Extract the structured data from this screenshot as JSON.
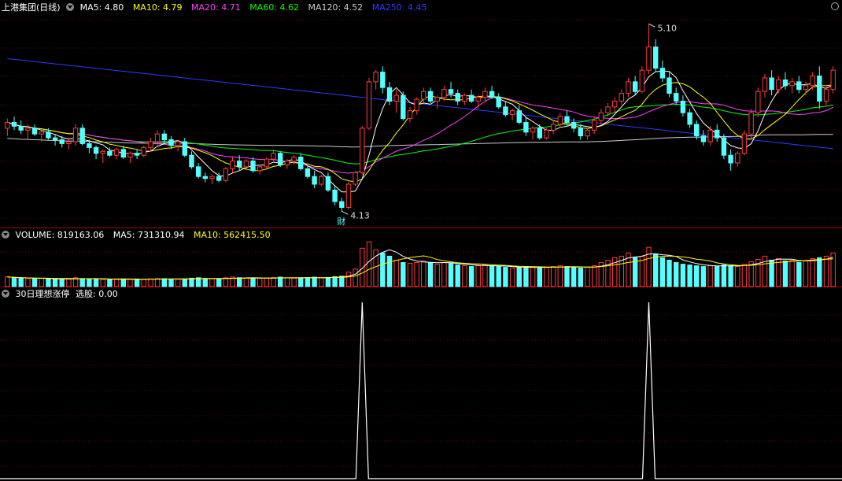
{
  "stock_name": "上港集团(日线)",
  "colors": {
    "up": "#ff3b3b",
    "down": "#54ffff",
    "ma5": "#ffffff",
    "ma10": "#ffff00",
    "ma20": "#ff40ff",
    "ma60": "#00ff00",
    "ma120": "#cccccc",
    "ma250": "#2b3bff",
    "grid": "#6b0000",
    "border": "#a00000"
  },
  "price_panel": {
    "legend": [
      {
        "key": "ma5",
        "label": "MA5: 4.80"
      },
      {
        "key": "ma10",
        "label": "MA10: 4.79"
      },
      {
        "key": "ma20",
        "label": "MA20: 4.71"
      },
      {
        "key": "ma60",
        "label": "MA60: 4.62"
      },
      {
        "key": "ma120",
        "label": "MA120: 4.52"
      },
      {
        "key": "ma250",
        "label": "MA250: 4.45"
      }
    ],
    "high_label": "5.10",
    "low_label": "4.13",
    "event_marker": "财"
  },
  "volume_panel": {
    "legend": [
      {
        "key": "vol",
        "label": "VOLUME: 819163.06",
        "color": "#ffffff"
      },
      {
        "key": "ma5",
        "label": "MA5: 731310.94",
        "color": "#ffffff"
      },
      {
        "key": "ma10",
        "label": "MA10: 562415.50",
        "color": "#ffff00"
      }
    ]
  },
  "indicator_panel": {
    "legend": [
      {
        "key": "name",
        "label": "30日理想涨停",
        "color": "#ffffff"
      },
      {
        "key": "val",
        "label": "选股: 0.00",
        "color": "#ffffff"
      }
    ]
  },
  "chart_data": {
    "type": "candlestick",
    "title": "上港集团(日线)",
    "ylim": [
      4.05,
      5.15
    ],
    "candles": [
      [
        4.56,
        4.61,
        4.52,
        4.59
      ],
      [
        4.59,
        4.62,
        4.55,
        4.57
      ],
      [
        4.57,
        4.6,
        4.53,
        4.55
      ],
      [
        4.55,
        4.58,
        4.5,
        4.56
      ],
      [
        4.56,
        4.58,
        4.52,
        4.53
      ],
      [
        4.53,
        4.55,
        4.49,
        4.54
      ],
      [
        4.54,
        4.56,
        4.5,
        4.51
      ],
      [
        4.51,
        4.53,
        4.47,
        4.5
      ],
      [
        4.5,
        4.52,
        4.46,
        4.48
      ],
      [
        4.48,
        4.51,
        4.45,
        4.49
      ],
      [
        4.49,
        4.58,
        4.47,
        4.56
      ],
      [
        4.56,
        4.58,
        4.47,
        4.48
      ],
      [
        4.48,
        4.5,
        4.43,
        4.46
      ],
      [
        4.46,
        4.47,
        4.4,
        4.43
      ],
      [
        4.43,
        4.45,
        4.38,
        4.44
      ],
      [
        4.44,
        4.46,
        4.41,
        4.42
      ],
      [
        4.42,
        4.46,
        4.4,
        4.45
      ],
      [
        4.45,
        4.47,
        4.4,
        4.41
      ],
      [
        4.41,
        4.44,
        4.38,
        4.43
      ],
      [
        4.43,
        4.45,
        4.4,
        4.42
      ],
      [
        4.42,
        4.47,
        4.41,
        4.46
      ],
      [
        4.46,
        4.51,
        4.44,
        4.49
      ],
      [
        4.49,
        4.55,
        4.47,
        4.53
      ],
      [
        4.53,
        4.55,
        4.48,
        4.5
      ],
      [
        4.5,
        4.52,
        4.45,
        4.47
      ],
      [
        4.47,
        4.5,
        4.44,
        4.49
      ],
      [
        4.49,
        4.51,
        4.41,
        4.42
      ],
      [
        4.42,
        4.44,
        4.35,
        4.36
      ],
      [
        4.36,
        4.38,
        4.3,
        4.31
      ],
      [
        4.31,
        4.33,
        4.28,
        4.3
      ],
      [
        4.3,
        4.32,
        4.27,
        4.31
      ],
      [
        4.31,
        4.33,
        4.28,
        4.29
      ],
      [
        4.29,
        4.36,
        4.28,
        4.35
      ],
      [
        4.35,
        4.41,
        4.33,
        4.39
      ],
      [
        4.39,
        4.42,
        4.34,
        4.36
      ],
      [
        4.36,
        4.4,
        4.35,
        4.39
      ],
      [
        4.39,
        4.41,
        4.33,
        4.34
      ],
      [
        4.34,
        4.37,
        4.32,
        4.36
      ],
      [
        4.36,
        4.41,
        4.35,
        4.4
      ],
      [
        4.4,
        4.45,
        4.38,
        4.43
      ],
      [
        4.43,
        4.44,
        4.36,
        4.37
      ],
      [
        4.37,
        4.4,
        4.35,
        4.39
      ],
      [
        4.39,
        4.42,
        4.37,
        4.41
      ],
      [
        4.41,
        4.43,
        4.34,
        4.35
      ],
      [
        4.35,
        4.37,
        4.3,
        4.31
      ],
      [
        4.31,
        4.34,
        4.25,
        4.27
      ],
      [
        4.27,
        4.32,
        4.26,
        4.31
      ],
      [
        4.31,
        4.33,
        4.23,
        4.24
      ],
      [
        4.24,
        4.26,
        4.16,
        4.18
      ],
      [
        4.18,
        4.2,
        4.13,
        4.15
      ],
      [
        4.15,
        4.28,
        4.14,
        4.27
      ],
      [
        4.27,
        4.34,
        4.26,
        4.33
      ],
      [
        4.33,
        4.57,
        4.32,
        4.56
      ],
      [
        4.56,
        4.82,
        4.55,
        4.8
      ],
      [
        4.8,
        4.86,
        4.76,
        4.85
      ],
      [
        4.85,
        4.88,
        4.74,
        4.77
      ],
      [
        4.77,
        4.8,
        4.68,
        4.7
      ],
      [
        4.7,
        4.76,
        4.64,
        4.73
      ],
      [
        4.73,
        4.75,
        4.6,
        4.61
      ],
      [
        4.61,
        4.67,
        4.59,
        4.65
      ],
      [
        4.65,
        4.72,
        4.63,
        4.71
      ],
      [
        4.71,
        4.77,
        4.69,
        4.75
      ],
      [
        4.75,
        4.77,
        4.69,
        4.7
      ],
      [
        4.7,
        4.73,
        4.66,
        4.72
      ],
      [
        4.72,
        4.78,
        4.7,
        4.76
      ],
      [
        4.76,
        4.8,
        4.72,
        4.74
      ],
      [
        4.74,
        4.76,
        4.68,
        4.7
      ],
      [
        4.7,
        4.74,
        4.68,
        4.73
      ],
      [
        4.73,
        4.76,
        4.69,
        4.7
      ],
      [
        4.7,
        4.73,
        4.66,
        4.72
      ],
      [
        4.72,
        4.77,
        4.7,
        4.75
      ],
      [
        4.75,
        4.78,
        4.71,
        4.72
      ],
      [
        4.72,
        4.74,
        4.66,
        4.67
      ],
      [
        4.67,
        4.7,
        4.62,
        4.63
      ],
      [
        4.63,
        4.66,
        4.6,
        4.65
      ],
      [
        4.65,
        4.68,
        4.58,
        4.59
      ],
      [
        4.59,
        4.62,
        4.52,
        4.54
      ],
      [
        4.54,
        4.57,
        4.5,
        4.56
      ],
      [
        4.56,
        4.58,
        4.5,
        4.51
      ],
      [
        4.51,
        4.56,
        4.5,
        4.55
      ],
      [
        4.55,
        4.6,
        4.53,
        4.58
      ],
      [
        4.58,
        4.64,
        4.56,
        4.62
      ],
      [
        4.62,
        4.65,
        4.57,
        4.59
      ],
      [
        4.59,
        4.61,
        4.54,
        4.56
      ],
      [
        4.56,
        4.58,
        4.5,
        4.52
      ],
      [
        4.52,
        4.56,
        4.5,
        4.55
      ],
      [
        4.55,
        4.62,
        4.53,
        4.6
      ],
      [
        4.6,
        4.66,
        4.58,
        4.64
      ],
      [
        4.64,
        4.69,
        4.62,
        4.67
      ],
      [
        4.67,
        4.72,
        4.64,
        4.7
      ],
      [
        4.7,
        4.76,
        4.68,
        4.74
      ],
      [
        4.74,
        4.82,
        4.72,
        4.8
      ],
      [
        4.8,
        4.83,
        4.73,
        4.75
      ],
      [
        4.75,
        4.88,
        4.74,
        4.86
      ],
      [
        4.86,
        5.1,
        4.84,
        4.98
      ],
      [
        4.98,
        5.02,
        4.85,
        4.87
      ],
      [
        4.87,
        4.91,
        4.8,
        4.82
      ],
      [
        4.82,
        4.85,
        4.72,
        4.74
      ],
      [
        4.74,
        4.77,
        4.68,
        4.7
      ],
      [
        4.7,
        4.73,
        4.62,
        4.64
      ],
      [
        4.64,
        4.66,
        4.56,
        4.58
      ],
      [
        4.58,
        4.6,
        4.5,
        4.52
      ],
      [
        4.52,
        4.55,
        4.47,
        4.49
      ],
      [
        4.49,
        4.57,
        4.47,
        4.55
      ],
      [
        4.55,
        4.58,
        4.49,
        4.51
      ],
      [
        4.51,
        4.53,
        4.4,
        4.42
      ],
      [
        4.42,
        4.45,
        4.34,
        4.38
      ],
      [
        4.38,
        4.44,
        4.36,
        4.43
      ],
      [
        4.43,
        4.55,
        4.42,
        4.53
      ],
      [
        4.53,
        4.66,
        4.51,
        4.64
      ],
      [
        4.64,
        4.77,
        4.62,
        4.75
      ],
      [
        4.75,
        4.84,
        4.72,
        4.82
      ],
      [
        4.82,
        4.86,
        4.73,
        4.76
      ],
      [
        4.76,
        4.83,
        4.74,
        4.81
      ],
      [
        4.81,
        4.85,
        4.76,
        4.78
      ],
      [
        4.78,
        4.82,
        4.74,
        4.8
      ],
      [
        4.8,
        4.83,
        4.74,
        4.76
      ],
      [
        4.76,
        4.8,
        4.73,
        4.78
      ],
      [
        4.78,
        4.85,
        4.76,
        4.83
      ],
      [
        4.83,
        4.88,
        4.66,
        4.7
      ],
      [
        4.7,
        4.78,
        4.68,
        4.76
      ],
      [
        4.76,
        4.88,
        4.74,
        4.86
      ]
    ],
    "volume": [
      120,
      110,
      105,
      100,
      98,
      102,
      95,
      90,
      92,
      95,
      110,
      100,
      96,
      94,
      90,
      88,
      92,
      95,
      90,
      88,
      92,
      96,
      100,
      98,
      94,
      92,
      96,
      104,
      110,
      100,
      98,
      96,
      110,
      120,
      110,
      104,
      108,
      102,
      106,
      112,
      118,
      108,
      104,
      110,
      112,
      118,
      108,
      114,
      124,
      130,
      180,
      220,
      480,
      560,
      460,
      420,
      380,
      330,
      300,
      290,
      300,
      320,
      300,
      280,
      300,
      290,
      270,
      260,
      250,
      260,
      270,
      260,
      250,
      240,
      230,
      240,
      250,
      240,
      230,
      240,
      250,
      260,
      250,
      240,
      230,
      240,
      260,
      300,
      330,
      360,
      380,
      420,
      360,
      380,
      490,
      400,
      360,
      330,
      300,
      280,
      270,
      260,
      250,
      260,
      250,
      270,
      260,
      250,
      280,
      310,
      340,
      380,
      330,
      350,
      320,
      330,
      300,
      320,
      350,
      360,
      380,
      420
    ],
    "indicator": {
      "name": "30日理想涨停",
      "signal_indices": [
        52,
        94
      ]
    }
  }
}
